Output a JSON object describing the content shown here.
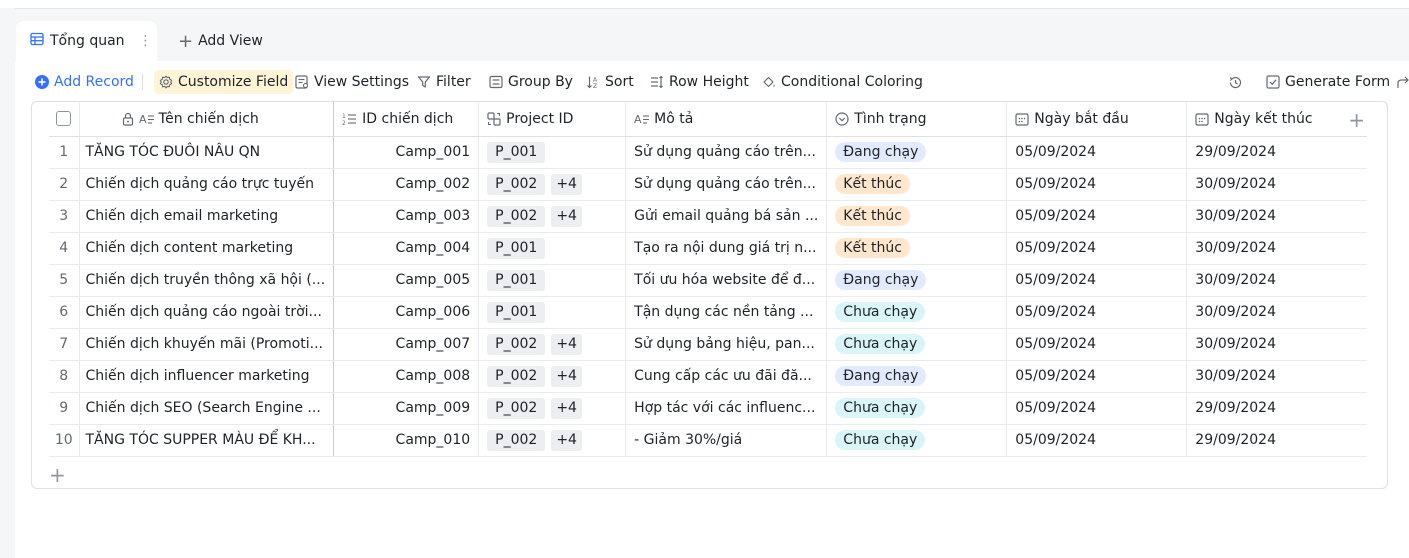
{
  "tabs": {
    "active_label": "Tổng quan",
    "add_view_label": "Add View"
  },
  "toolbar": {
    "add_record": "Add Record",
    "customize_field": "Customize Field",
    "view_settings": "View Settings",
    "filter": "Filter",
    "group_by": "Group By",
    "sort": "Sort",
    "row_height": "Row Height",
    "conditional_coloring": "Conditional Coloring",
    "generate_form": "Generate Form"
  },
  "colors": {
    "accent": "#3370ff",
    "status_running_bg": "#e1eaff",
    "status_ended_bg": "#fee7cd",
    "status_not_started_bg": "#d9f5f6"
  },
  "table": {
    "columns": {
      "name": "Tên chiến dịch",
      "id": "ID chiến dịch",
      "project": "Project ID",
      "desc": "Mô tả",
      "status": "Tình trạng",
      "start": "Ngày bắt đầu",
      "end": "Ngày kết thúc"
    },
    "rows": [
      {
        "num": "1",
        "name": "TĂNG TÓC ĐUÔI NÂU QN",
        "id": "Camp_001",
        "project": "P_001",
        "extra": "",
        "desc": "Sử dụng quảng cáo trên...",
        "status": "Đang chạy",
        "status_kind": "running",
        "start": "05/09/2024",
        "end": "29/09/2024"
      },
      {
        "num": "2",
        "name": "Chiến dịch quảng cáo trực tuyến",
        "id": "Camp_002",
        "project": "P_002",
        "extra": "+4",
        "desc": "Sử dụng quảng cáo trên...",
        "status": "Kết thúc",
        "status_kind": "ended",
        "start": "05/09/2024",
        "end": "30/09/2024"
      },
      {
        "num": "3",
        "name": "Chiến dịch email marketing",
        "id": "Camp_003",
        "project": "P_002",
        "extra": "+4",
        "desc": "Gửi email quảng bá sản ...",
        "status": "Kết thúc",
        "status_kind": "ended",
        "start": "05/09/2024",
        "end": "30/09/2024"
      },
      {
        "num": "4",
        "name": "Chiến dịch content marketing",
        "id": "Camp_004",
        "project": "P_001",
        "extra": "",
        "desc": "Tạo ra nội dung giá trị n...",
        "status": "Kết thúc",
        "status_kind": "ended",
        "start": "05/09/2024",
        "end": "30/09/2024"
      },
      {
        "num": "5",
        "name": "Chiến dịch truyền thông xã hội (...",
        "id": "Camp_005",
        "project": "P_001",
        "extra": "",
        "desc": "Tối ưu hóa website để đ...",
        "status": "Đang chạy",
        "status_kind": "running",
        "start": "05/09/2024",
        "end": "30/09/2024"
      },
      {
        "num": "6",
        "name": "Chiến dịch quảng cáo ngoài trời...",
        "id": "Camp_006",
        "project": "P_001",
        "extra": "",
        "desc": "Tận dụng các nền tảng ...",
        "status": "Chưa chạy",
        "status_kind": "not_started",
        "start": "05/09/2024",
        "end": "30/09/2024"
      },
      {
        "num": "7",
        "name": "Chiến dịch khuyến mãi (Promoti...",
        "id": "Camp_007",
        "project": "P_002",
        "extra": "+4",
        "desc": "Sử dụng bảng hiệu, pan...",
        "status": "Chưa chạy",
        "status_kind": "not_started",
        "start": "05/09/2024",
        "end": "30/09/2024"
      },
      {
        "num": "8",
        "name": "Chiến dịch influencer marketing",
        "id": "Camp_008",
        "project": "P_002",
        "extra": "+4",
        "desc": "Cung cấp các ưu đãi đă...",
        "status": "Đang chạy",
        "status_kind": "running",
        "start": "05/09/2024",
        "end": "30/09/2024"
      },
      {
        "num": "9",
        "name": "Chiến dịch SEO (Search Engine ...",
        "id": "Camp_009",
        "project": "P_002",
        "extra": "+4",
        "desc": "Hợp tác với các influenc...",
        "status": "Chưa chạy",
        "status_kind": "not_started",
        "start": "05/09/2024",
        "end": "29/09/2024"
      },
      {
        "num": "10",
        "name": "TĂNG TÓC SUPPER MÀU ĐỂ KH...",
        "id": "Camp_010",
        "project": "P_002",
        "extra": "+4",
        "desc": "- Giảm 30%/giá",
        "status": "Chưa chạy",
        "status_kind": "not_started",
        "start": "05/09/2024",
        "end": "29/09/2024"
      }
    ]
  }
}
